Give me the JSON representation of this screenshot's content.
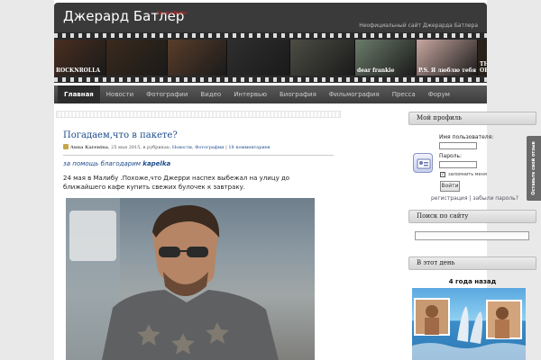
{
  "header": {
    "site_title": "Джерард Батлер",
    "badge": "Gerard Butler",
    "tagline": "Неофициальный сайт Джерарда Батлера"
  },
  "filmstrip": {
    "frames": [
      {
        "label": "ROCKNROLLA",
        "color": "#4a2e20"
      },
      {
        "label": "",
        "color": "#3b2a1c"
      },
      {
        "label": "",
        "color": "#5a3d2a"
      },
      {
        "label": "",
        "color": "#2f2f2f"
      },
      {
        "label": "",
        "color": "#4d4d45"
      },
      {
        "label": "dear frankie",
        "color": "#6b7c6a"
      },
      {
        "label": "P.S. Я люблю тебя",
        "color": "#c8a7a0"
      },
      {
        "label": "THE PHANTOM OF THE OPERA",
        "color": "#2a2218"
      }
    ]
  },
  "nav": {
    "items": [
      "Главная",
      "Новости",
      "Фотографии",
      "Видео",
      "Интервью",
      "Биография",
      "Фильмография",
      "Пресса",
      "Форум"
    ],
    "active_index": 0
  },
  "post": {
    "title": "Погадаем,что в пакете?",
    "author": "Anna Karenina",
    "date": ", 25 мая 2015, в рубриках:",
    "categories": "Новости, Фотографии",
    "comments": "18 комментариев",
    "thanks_prefix": "за помощь благодарим",
    "thanks_name": "kapelka",
    "body": "24 мая в Малибу .Похоже,что Джерри наспех выбежал на улицу до ближайшего кафе купить свежих булочек к завтраку."
  },
  "sidebar": {
    "profile": {
      "heading": "Мой профиль",
      "username_label": "Имя пользователя:",
      "password_label": "Пароль:",
      "remember_label": "запомнить меня",
      "button_label": "Войти",
      "register_link": "регистрация",
      "separator": "|",
      "forgot_link": "забыли пароль?"
    },
    "search": {
      "heading": "Поиск по сайту"
    },
    "onthisday": {
      "heading": "В этот день",
      "label": "4 года назад"
    }
  },
  "feedback_tab": "Оставьте свой отзыв",
  "colors": {
    "link": "#1a4a8a",
    "header_bg": "#3a3a3a",
    "nav_active": "#2c2c2c"
  }
}
